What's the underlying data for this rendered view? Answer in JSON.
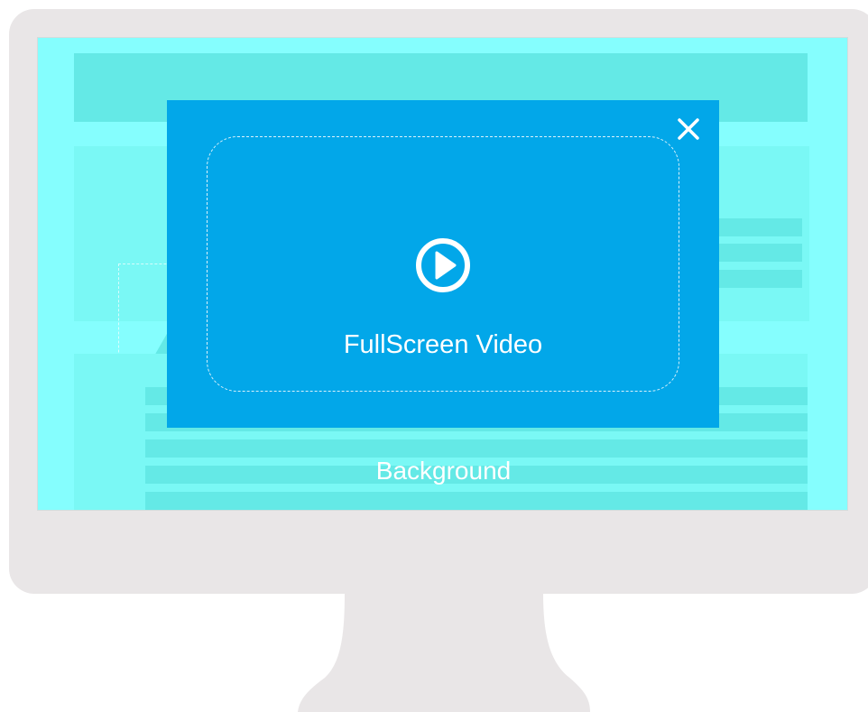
{
  "screen": {
    "background_label": "Background"
  },
  "video_overlay": {
    "label": "FullScreen Video",
    "play_icon": "play-circle-icon",
    "close_icon": "close-icon"
  },
  "colors": {
    "monitor_frame": "#e9e6e7",
    "screen_background": "#85fefe",
    "background_blocks": "#64e9e6",
    "overlay_fill": "#02a7e9",
    "overlay_text": "#ffffff"
  }
}
